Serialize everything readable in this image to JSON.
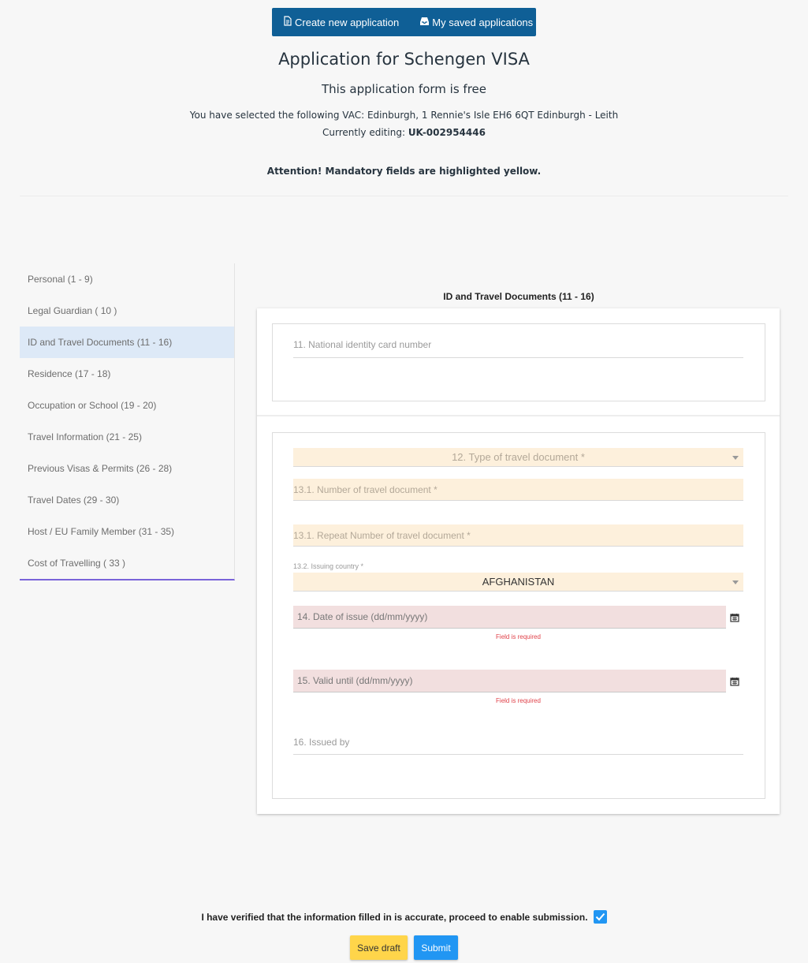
{
  "header": {
    "create_label": "Create new application",
    "saved_label": "My saved applications",
    "title": "Application for Schengen VISA",
    "subtitle": "This application form is free",
    "vac_text": "You have selected the following VAC: Edinburgh, 1 Rennie's Isle EH6 6QT Edinburgh - Leith",
    "editing_label": "Currently editing: ",
    "editing_value": "UK-002954446",
    "attention": "Attention! Mandatory fields are highlighted yellow."
  },
  "sidebar": {
    "items": [
      {
        "label": "Personal (1 - 9)"
      },
      {
        "label": "Legal Guardian ( 10 )"
      },
      {
        "label": "ID and Travel Documents (11 - 16)"
      },
      {
        "label": "Residence (17 - 18)"
      },
      {
        "label": "Occupation or School (19 - 20)"
      },
      {
        "label": "Travel Information (21 - 25)"
      },
      {
        "label": "Previous Visas & Permits (26 - 28)"
      },
      {
        "label": "Travel Dates (29 - 30)"
      },
      {
        "label": "Host / EU Family Member (31 - 35)"
      },
      {
        "label": "Cost of Travelling ( 33 )"
      }
    ],
    "active_index": 2
  },
  "section": {
    "title": "ID and Travel Documents (11 - 16)",
    "f11_label": "11. National identity card number",
    "f12_placeholder": "12. Type of travel document *",
    "f13_number_placeholder": "13.1. Number of travel document *",
    "f13_repeat_placeholder": "13.1. Repeat Number of travel document *",
    "f13_2_label": "13.2. Issuing country *",
    "f13_2_value": "AFGHANISTAN",
    "f14_placeholder": "14. Date of issue (dd/mm/yyyy)",
    "f15_placeholder": "15. Valid until (dd/mm/yyyy)",
    "error_text": "Field is required",
    "f16_label": "16. Issued by"
  },
  "footer": {
    "verify_text": "I have verified that the information filled in is accurate, proceed to enable submission.",
    "verified": true,
    "save_label": "Save draft",
    "submit_label": "Submit"
  },
  "colors": {
    "primary": "#0f5f96",
    "mandatory": "#fdf0dc",
    "invalid": "#f2dfdf",
    "accent": "#2196f3",
    "draft": "#ffd54a",
    "error": "#e0424a"
  }
}
